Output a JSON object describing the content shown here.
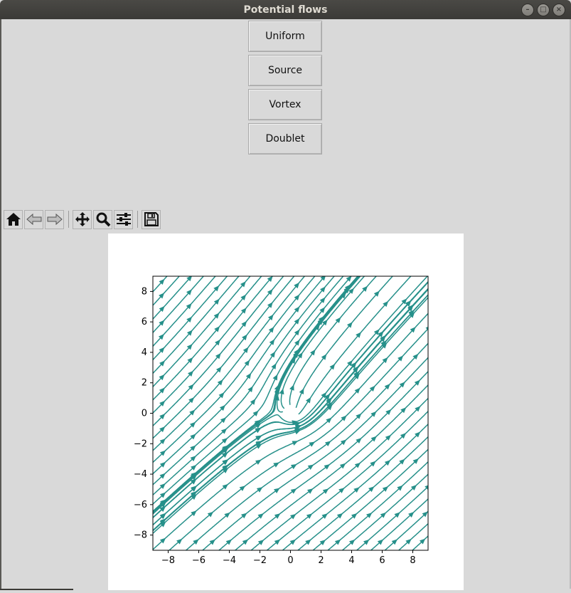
{
  "window": {
    "title": "Potential flows"
  },
  "buttons": {
    "uniform": "Uniform",
    "source": "Source",
    "vortex": "Vortex",
    "doublet": "Doublet"
  },
  "toolbar": {
    "icons": [
      "home-icon",
      "back-icon",
      "forward-icon",
      "pan-icon",
      "zoom-icon",
      "configure-subplots-icon",
      "save-icon"
    ]
  },
  "colors": {
    "stream": "#26908a",
    "stream_bright": "#35b779",
    "axes": "#000000"
  },
  "chart_data": {
    "type": "streamplot",
    "title": "",
    "xlabel": "",
    "ylabel": "",
    "xlim": [
      -9,
      9
    ],
    "ylim": [
      -9,
      9
    ],
    "xticks": [
      -8,
      -6,
      -4,
      -2,
      0,
      2,
      4,
      6,
      8
    ],
    "yticks": [
      -8,
      -6,
      -4,
      -2,
      0,
      2,
      4,
      6,
      8
    ],
    "xtick_labels": [
      "−8",
      "−6",
      "−4",
      "−2",
      "0",
      "2",
      "4",
      "6",
      "8"
    ],
    "ytick_labels": [
      "−8",
      "−6",
      "−4",
      "−2",
      "0",
      "2",
      "4",
      "6",
      "8"
    ],
    "flow": {
      "uniform": {
        "u": 1.0,
        "v": 1.0
      },
      "elements": [
        {
          "kind": "source",
          "x": 0,
          "y": 0,
          "strength": 5
        },
        {
          "kind": "vortex",
          "x": 0,
          "y": 0,
          "strength": 5
        }
      ]
    },
    "grid": false
  }
}
